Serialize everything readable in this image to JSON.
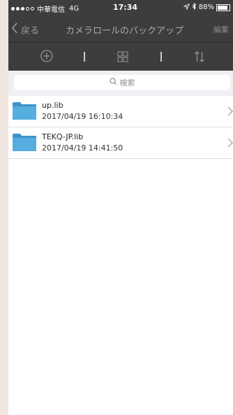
{
  "status_bar": {
    "carrier": "中華電信",
    "network": "4G",
    "time": "17:34",
    "battery": "88%",
    "battery_level": 0.88
  },
  "nav": {
    "back_label": "戻る",
    "title": "カメラロールのバックアップ",
    "edit_label": "編集"
  },
  "toolbar": {
    "icons": [
      "plus-circle-icon",
      "grid-icon",
      "sort-icon"
    ]
  },
  "search": {
    "placeholder": "検索"
  },
  "files": [
    {
      "name": "up.lib",
      "date": "2017/04/19 16:10:34"
    },
    {
      "name": "TEKQ-JP.lib",
      "date": "2017/04/19 14:41:50"
    }
  ],
  "colors": {
    "bar_bg": "#3d3d3d",
    "folder_blue": "#3d93c7",
    "page_bg": "#ffffff"
  }
}
